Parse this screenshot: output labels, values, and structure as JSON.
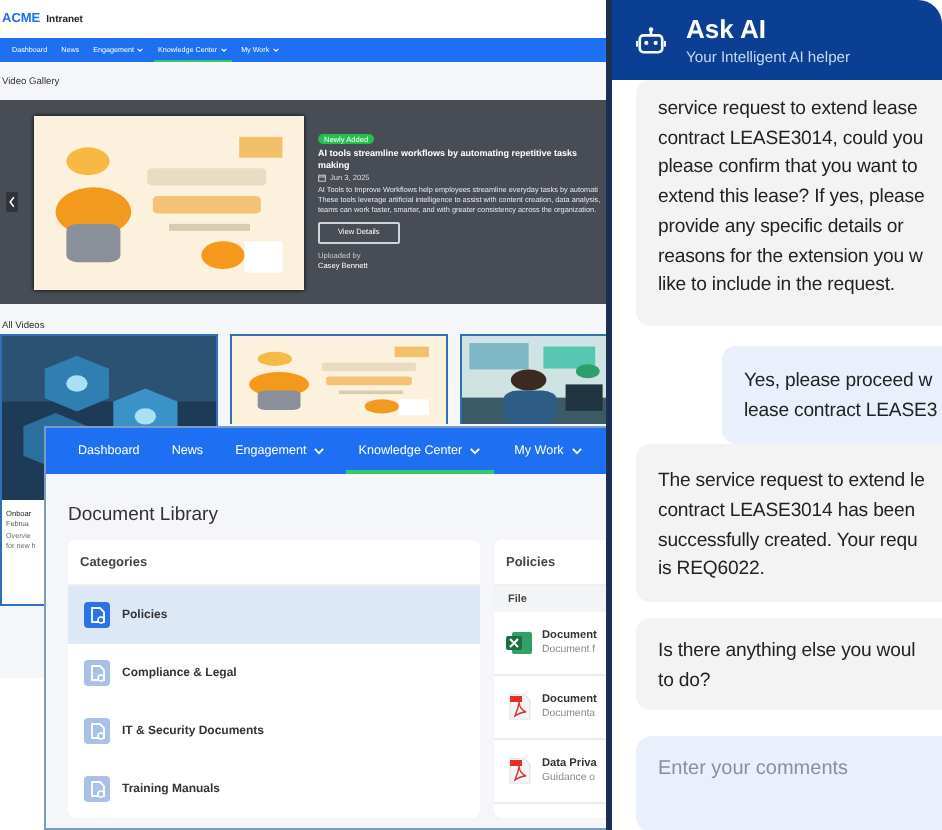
{
  "intranet": {
    "brand": "ACME",
    "app_name": "Intranet",
    "nav": [
      {
        "label": "Dashboard",
        "selected": false,
        "dropdown": false
      },
      {
        "label": "News",
        "selected": false,
        "dropdown": false
      },
      {
        "label": "Engagement",
        "selected": false,
        "dropdown": true
      },
      {
        "label": "Knowledge Center",
        "selected": true,
        "dropdown": true
      },
      {
        "label": "My Work",
        "selected": false,
        "dropdown": true
      }
    ],
    "video_gallery": {
      "heading": "Video Gallery",
      "featured": {
        "kind": "picture",
        "badge": "Newly Added",
        "title": "AI tools streamline workflows by automating repetitive tasks\nmaking",
        "date": "Jun 3, 2025",
        "description": "AI Tools to Improve Workflows help employees streamline everyday tasks by automati\nThese tools leverage artificial intelligence to assist with content creation, data analysis,\nteams can work faster, smarter, and with greater consistency across the organization.",
        "button": "View Details",
        "uploaded_label": "Uploaded by",
        "uploader": "Casey Bennett"
      }
    },
    "all_videos": {
      "heading": "All Videos",
      "cards": [
        {
          "kind": "picture",
          "title": "Onboar",
          "date": "Februa",
          "description": "Overvie\nfor new h"
        },
        {
          "kind": "picture"
        },
        {
          "kind": "picture"
        }
      ]
    }
  },
  "document_library": {
    "nav": [
      {
        "label": "Dashboard",
        "selected": false,
        "dropdown": false
      },
      {
        "label": "News",
        "selected": false,
        "dropdown": false
      },
      {
        "label": "Engagement",
        "selected": false,
        "dropdown": true
      },
      {
        "label": "Knowledge Center",
        "selected": true,
        "dropdown": true
      },
      {
        "label": "My Work",
        "selected": false,
        "dropdown": true
      }
    ],
    "title": "Document Library",
    "categories": {
      "heading": "Categories",
      "items": [
        {
          "label": "Policies",
          "selected": true
        },
        {
          "label": "Compliance & Legal",
          "selected": false
        },
        {
          "label": "IT & Security Documents",
          "selected": false
        },
        {
          "label": "Training Manuals",
          "selected": false
        }
      ]
    },
    "files": {
      "heading": "Policies",
      "column": "File",
      "rows": [
        {
          "kind": "xlsx",
          "name": "Document",
          "detail": "Document f"
        },
        {
          "kind": "pdf",
          "name": "Document",
          "detail": "Documenta"
        },
        {
          "kind": "pdf",
          "name": "Data Priva",
          "detail": "Guidance o"
        }
      ]
    }
  },
  "chat": {
    "title": "Ask AI",
    "subtitle": "Your Intelligent AI helper",
    "messages": [
      {
        "kind": "assistant",
        "text": "service request to extend lease\ncontract LEASE3014, could you\nplease confirm that you want to\nextend this lease? If yes, please\nprovide any specific details or\nreasons for the extension you w\nlike to include in the request."
      },
      {
        "kind": "user",
        "text": "Yes, please proceed w\nlease contract LEASE3"
      },
      {
        "kind": "assistant",
        "text": "The service request to extend le\ncontract LEASE3014 has been\nsuccessfully created. Your requ\nis REQ6022."
      },
      {
        "kind": "assistant",
        "text": "Is there anything else you woul\nto do?"
      }
    ],
    "input": {
      "placeholder": "Enter your comments"
    }
  }
}
